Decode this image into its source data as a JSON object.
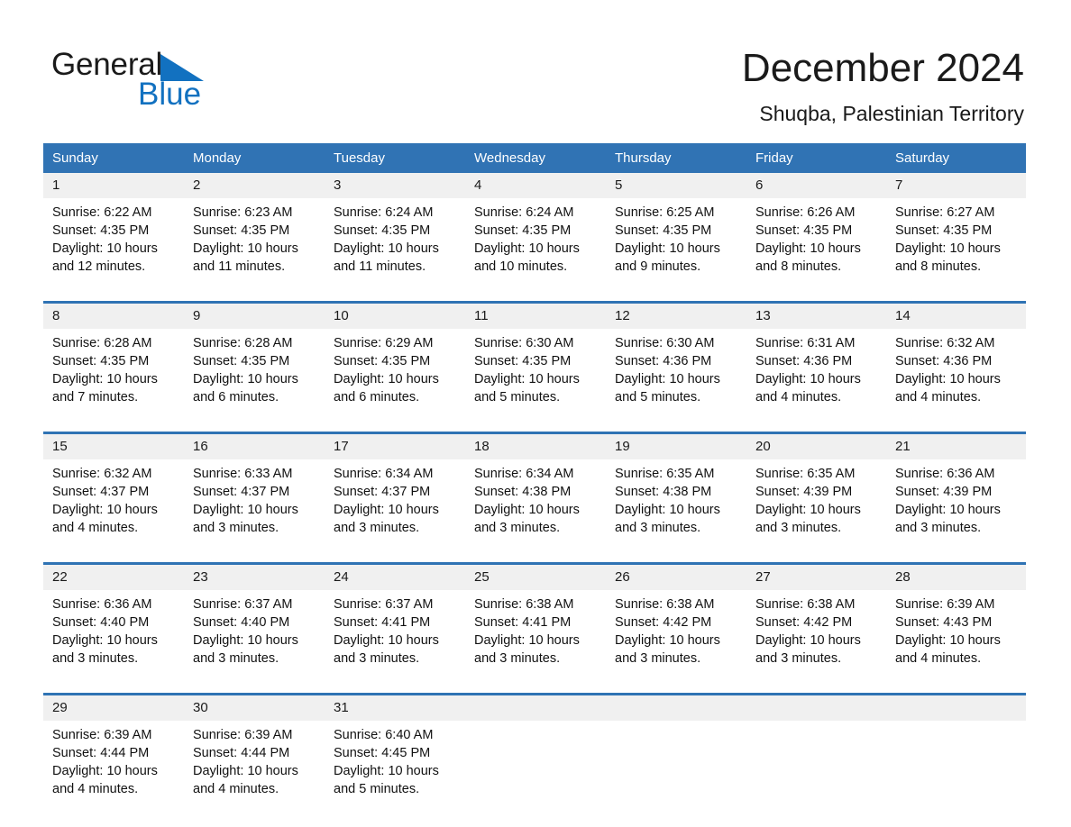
{
  "brand": {
    "line1": "General",
    "line2": "Blue",
    "triangle_icon": "blue-triangle-icon",
    "blue": "#1271c0"
  },
  "title": {
    "month_year": "December 2024",
    "location": "Shuqba, Palestinian Territory"
  },
  "colors": {
    "header_blue": "#3073b4",
    "row_divider_blue": "#2f73b4",
    "daynum_band": "#f0f0f0",
    "text": "#1a1a1a"
  },
  "weekday_headers": [
    "Sunday",
    "Monday",
    "Tuesday",
    "Wednesday",
    "Thursday",
    "Friday",
    "Saturday"
  ],
  "weeks": [
    {
      "days": [
        {
          "num": "1",
          "sunrise": "Sunrise: 6:22 AM",
          "sunset": "Sunset: 4:35 PM",
          "daylight1": "Daylight: 10 hours",
          "daylight2": "and 12 minutes."
        },
        {
          "num": "2",
          "sunrise": "Sunrise: 6:23 AM",
          "sunset": "Sunset: 4:35 PM",
          "daylight1": "Daylight: 10 hours",
          "daylight2": "and 11 minutes."
        },
        {
          "num": "3",
          "sunrise": "Sunrise: 6:24 AM",
          "sunset": "Sunset: 4:35 PM",
          "daylight1": "Daylight: 10 hours",
          "daylight2": "and 11 minutes."
        },
        {
          "num": "4",
          "sunrise": "Sunrise: 6:24 AM",
          "sunset": "Sunset: 4:35 PM",
          "daylight1": "Daylight: 10 hours",
          "daylight2": "and 10 minutes."
        },
        {
          "num": "5",
          "sunrise": "Sunrise: 6:25 AM",
          "sunset": "Sunset: 4:35 PM",
          "daylight1": "Daylight: 10 hours",
          "daylight2": "and 9 minutes."
        },
        {
          "num": "6",
          "sunrise": "Sunrise: 6:26 AM",
          "sunset": "Sunset: 4:35 PM",
          "daylight1": "Daylight: 10 hours",
          "daylight2": "and 8 minutes."
        },
        {
          "num": "7",
          "sunrise": "Sunrise: 6:27 AM",
          "sunset": "Sunset: 4:35 PM",
          "daylight1": "Daylight: 10 hours",
          "daylight2": "and 8 minutes."
        }
      ]
    },
    {
      "days": [
        {
          "num": "8",
          "sunrise": "Sunrise: 6:28 AM",
          "sunset": "Sunset: 4:35 PM",
          "daylight1": "Daylight: 10 hours",
          "daylight2": "and 7 minutes."
        },
        {
          "num": "9",
          "sunrise": "Sunrise: 6:28 AM",
          "sunset": "Sunset: 4:35 PM",
          "daylight1": "Daylight: 10 hours",
          "daylight2": "and 6 minutes."
        },
        {
          "num": "10",
          "sunrise": "Sunrise: 6:29 AM",
          "sunset": "Sunset: 4:35 PM",
          "daylight1": "Daylight: 10 hours",
          "daylight2": "and 6 minutes."
        },
        {
          "num": "11",
          "sunrise": "Sunrise: 6:30 AM",
          "sunset": "Sunset: 4:35 PM",
          "daylight1": "Daylight: 10 hours",
          "daylight2": "and 5 minutes."
        },
        {
          "num": "12",
          "sunrise": "Sunrise: 6:30 AM",
          "sunset": "Sunset: 4:36 PM",
          "daylight1": "Daylight: 10 hours",
          "daylight2": "and 5 minutes."
        },
        {
          "num": "13",
          "sunrise": "Sunrise: 6:31 AM",
          "sunset": "Sunset: 4:36 PM",
          "daylight1": "Daylight: 10 hours",
          "daylight2": "and 4 minutes."
        },
        {
          "num": "14",
          "sunrise": "Sunrise: 6:32 AM",
          "sunset": "Sunset: 4:36 PM",
          "daylight1": "Daylight: 10 hours",
          "daylight2": "and 4 minutes."
        }
      ]
    },
    {
      "days": [
        {
          "num": "15",
          "sunrise": "Sunrise: 6:32 AM",
          "sunset": "Sunset: 4:37 PM",
          "daylight1": "Daylight: 10 hours",
          "daylight2": "and 4 minutes."
        },
        {
          "num": "16",
          "sunrise": "Sunrise: 6:33 AM",
          "sunset": "Sunset: 4:37 PM",
          "daylight1": "Daylight: 10 hours",
          "daylight2": "and 3 minutes."
        },
        {
          "num": "17",
          "sunrise": "Sunrise: 6:34 AM",
          "sunset": "Sunset: 4:37 PM",
          "daylight1": "Daylight: 10 hours",
          "daylight2": "and 3 minutes."
        },
        {
          "num": "18",
          "sunrise": "Sunrise: 6:34 AM",
          "sunset": "Sunset: 4:38 PM",
          "daylight1": "Daylight: 10 hours",
          "daylight2": "and 3 minutes."
        },
        {
          "num": "19",
          "sunrise": "Sunrise: 6:35 AM",
          "sunset": "Sunset: 4:38 PM",
          "daylight1": "Daylight: 10 hours",
          "daylight2": "and 3 minutes."
        },
        {
          "num": "20",
          "sunrise": "Sunrise: 6:35 AM",
          "sunset": "Sunset: 4:39 PM",
          "daylight1": "Daylight: 10 hours",
          "daylight2": "and 3 minutes."
        },
        {
          "num": "21",
          "sunrise": "Sunrise: 6:36 AM",
          "sunset": "Sunset: 4:39 PM",
          "daylight1": "Daylight: 10 hours",
          "daylight2": "and 3 minutes."
        }
      ]
    },
    {
      "days": [
        {
          "num": "22",
          "sunrise": "Sunrise: 6:36 AM",
          "sunset": "Sunset: 4:40 PM",
          "daylight1": "Daylight: 10 hours",
          "daylight2": "and 3 minutes."
        },
        {
          "num": "23",
          "sunrise": "Sunrise: 6:37 AM",
          "sunset": "Sunset: 4:40 PM",
          "daylight1": "Daylight: 10 hours",
          "daylight2": "and 3 minutes."
        },
        {
          "num": "24",
          "sunrise": "Sunrise: 6:37 AM",
          "sunset": "Sunset: 4:41 PM",
          "daylight1": "Daylight: 10 hours",
          "daylight2": "and 3 minutes."
        },
        {
          "num": "25",
          "sunrise": "Sunrise: 6:38 AM",
          "sunset": "Sunset: 4:41 PM",
          "daylight1": "Daylight: 10 hours",
          "daylight2": "and 3 minutes."
        },
        {
          "num": "26",
          "sunrise": "Sunrise: 6:38 AM",
          "sunset": "Sunset: 4:42 PM",
          "daylight1": "Daylight: 10 hours",
          "daylight2": "and 3 minutes."
        },
        {
          "num": "27",
          "sunrise": "Sunrise: 6:38 AM",
          "sunset": "Sunset: 4:42 PM",
          "daylight1": "Daylight: 10 hours",
          "daylight2": "and 3 minutes."
        },
        {
          "num": "28",
          "sunrise": "Sunrise: 6:39 AM",
          "sunset": "Sunset: 4:43 PM",
          "daylight1": "Daylight: 10 hours",
          "daylight2": "and 4 minutes."
        }
      ]
    },
    {
      "days": [
        {
          "num": "29",
          "sunrise": "Sunrise: 6:39 AM",
          "sunset": "Sunset: 4:44 PM",
          "daylight1": "Daylight: 10 hours",
          "daylight2": "and 4 minutes."
        },
        {
          "num": "30",
          "sunrise": "Sunrise: 6:39 AM",
          "sunset": "Sunset: 4:44 PM",
          "daylight1": "Daylight: 10 hours",
          "daylight2": "and 4 minutes."
        },
        {
          "num": "31",
          "sunrise": "Sunrise: 6:40 AM",
          "sunset": "Sunset: 4:45 PM",
          "daylight1": "Daylight: 10 hours",
          "daylight2": "and 5 minutes."
        },
        {
          "num": "",
          "sunrise": "",
          "sunset": "",
          "daylight1": "",
          "daylight2": ""
        },
        {
          "num": "",
          "sunrise": "",
          "sunset": "",
          "daylight1": "",
          "daylight2": ""
        },
        {
          "num": "",
          "sunrise": "",
          "sunset": "",
          "daylight1": "",
          "daylight2": ""
        },
        {
          "num": "",
          "sunrise": "",
          "sunset": "",
          "daylight1": "",
          "daylight2": ""
        }
      ]
    }
  ]
}
